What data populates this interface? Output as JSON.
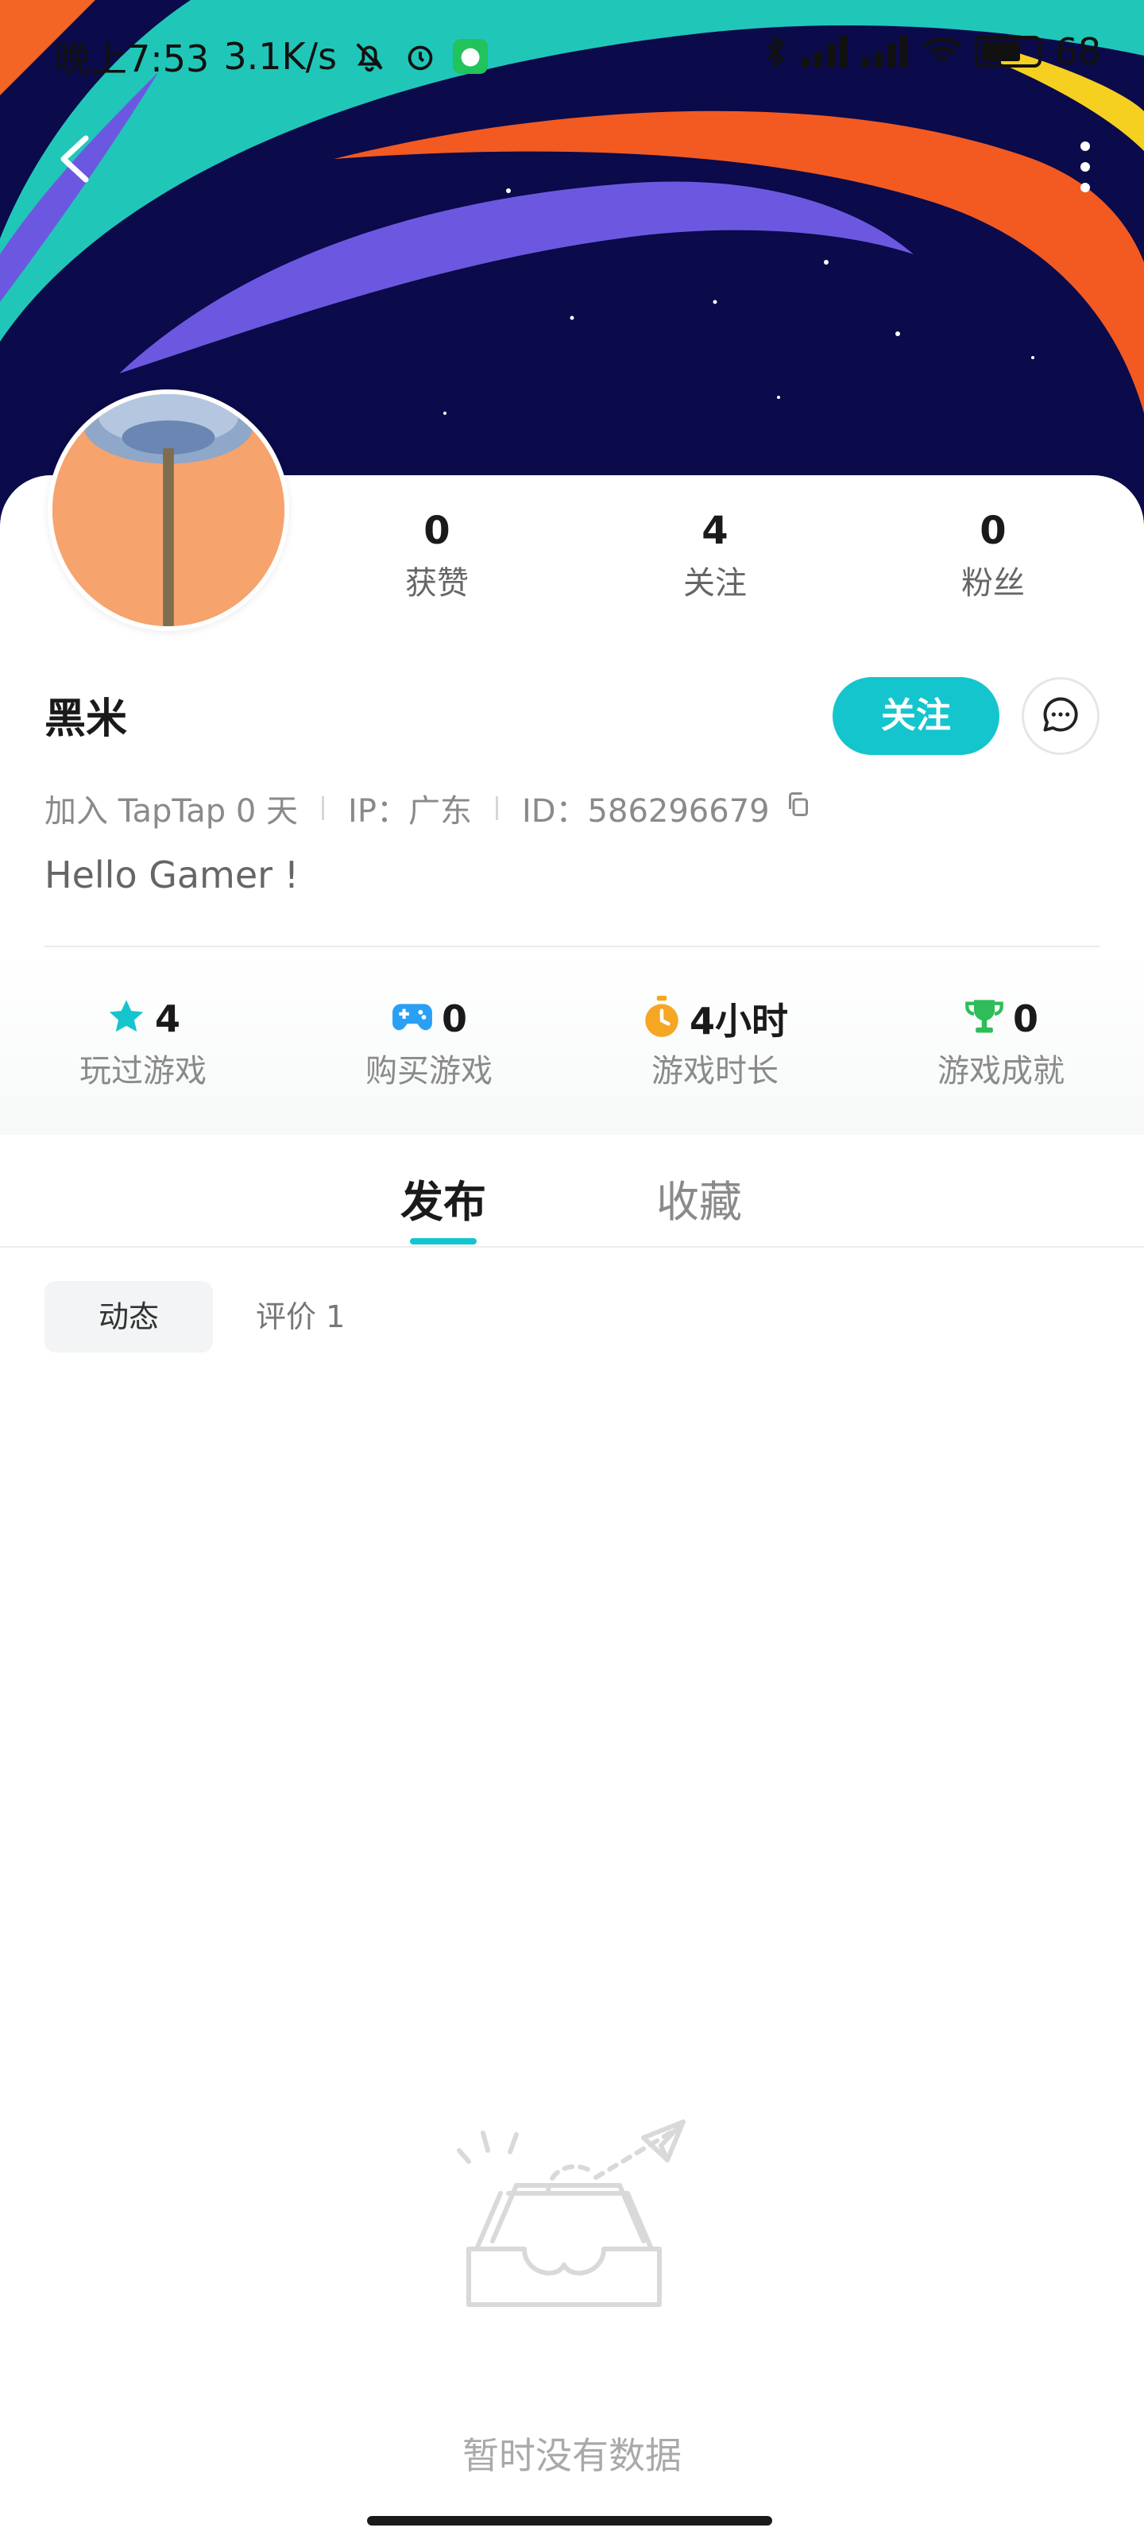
{
  "status_bar": {
    "time": "晚上7:53",
    "speed": "3.1K/s",
    "battery": "68"
  },
  "header": {
    "back_icon": "chevron-left-icon",
    "more_icon": "more-vertical-icon"
  },
  "profile": {
    "name": "黑米",
    "follow_label": "关注",
    "message_icon": "chat-bubble-icon",
    "stats": [
      {
        "value": "0",
        "label": "获赞"
      },
      {
        "value": "4",
        "label": "关注"
      },
      {
        "value": "0",
        "label": "粉丝"
      }
    ],
    "joined": "加入 TapTap 0 天",
    "ip": "IP：广东",
    "id": "ID：586296679",
    "bio": "Hello Gamer !"
  },
  "game_stats": [
    {
      "icon": "star-icon",
      "color": "#15c5ce",
      "value": "4",
      "label": "玩过游戏"
    },
    {
      "icon": "gamepad-icon",
      "color": "#2aa0f5",
      "value": "0",
      "label": "购买游戏"
    },
    {
      "icon": "stopwatch-icon",
      "color": "#f5a623",
      "value": "4小时",
      "label": "游戏时长"
    },
    {
      "icon": "trophy-icon",
      "color": "#2ebd59",
      "value": "0",
      "label": "游戏成就"
    }
  ],
  "tabs": [
    {
      "label": "发布",
      "active": true
    },
    {
      "label": "收藏",
      "active": false
    }
  ],
  "subtabs": [
    {
      "label": "动态",
      "active": true
    },
    {
      "label": "评价 1",
      "active": false
    }
  ],
  "empty_state": {
    "icon": "empty-inbox-icon",
    "text": "暂时没有数据"
  },
  "colors": {
    "accent": "#15c5ce",
    "banner_bg": "#0b0a4a"
  }
}
